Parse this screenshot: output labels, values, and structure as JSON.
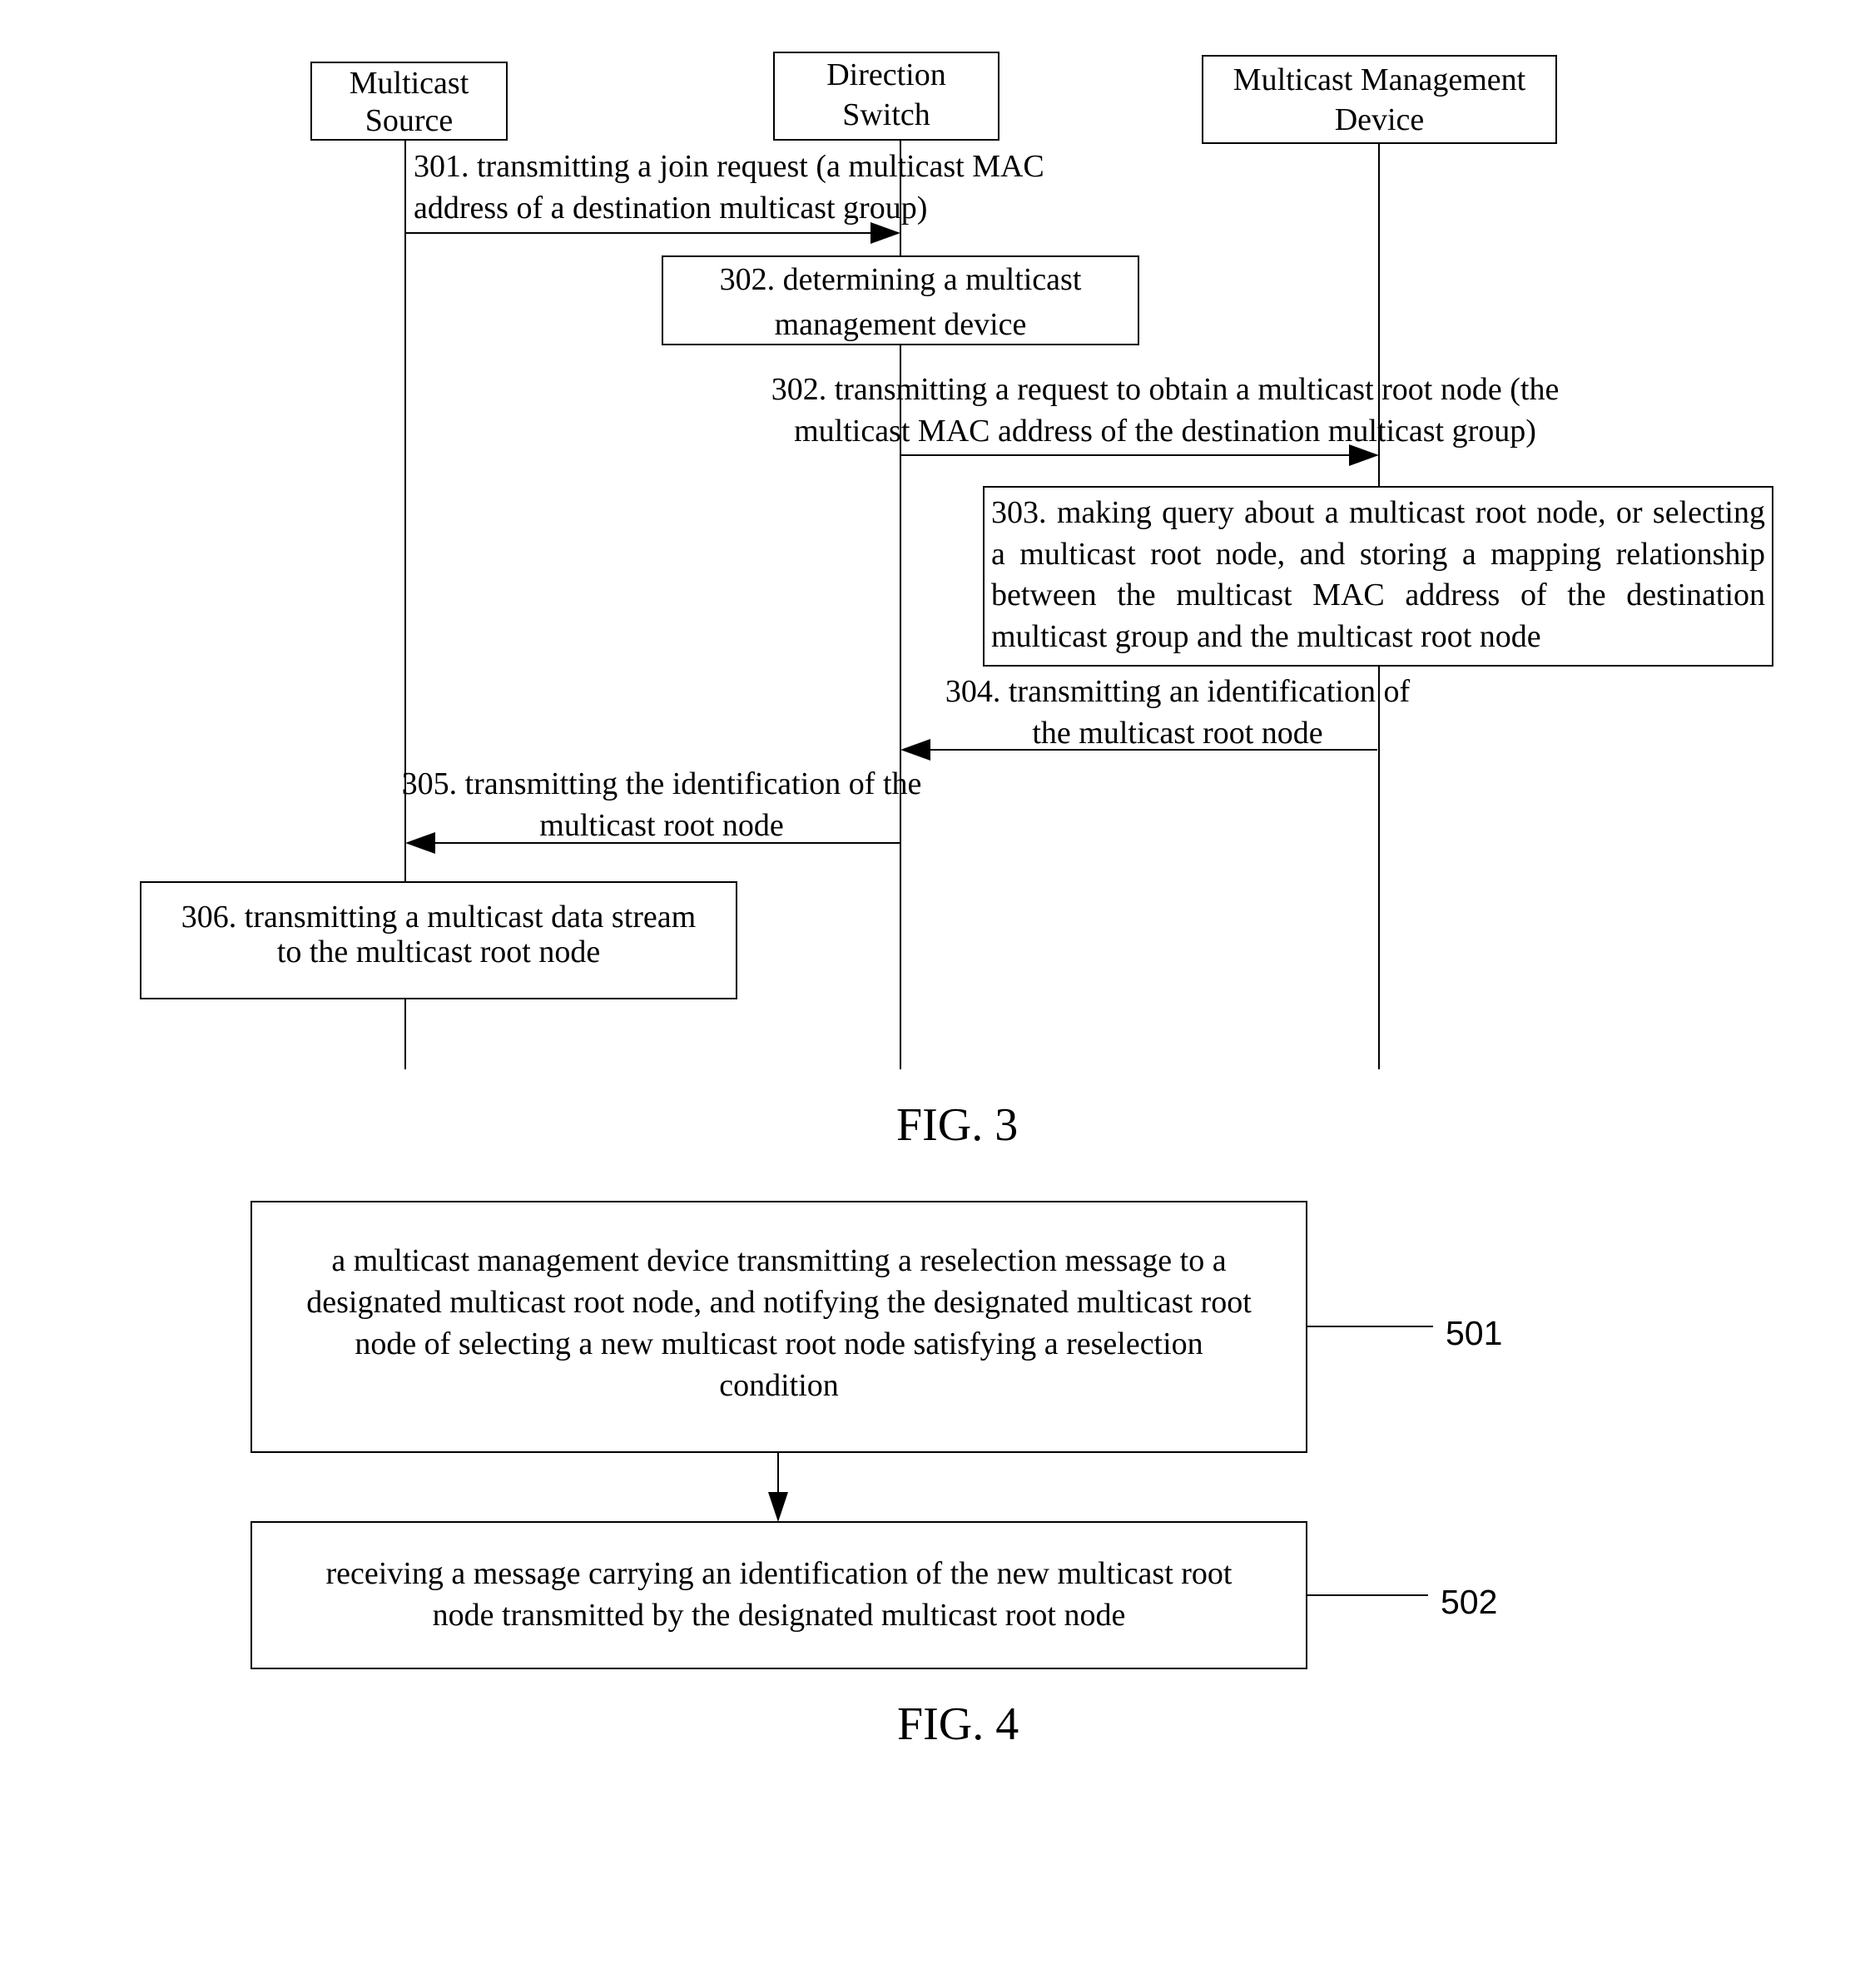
{
  "fig3": {
    "caption": "FIG. 3",
    "participants": [
      {
        "id": "multicast-source",
        "lines": [
          "Multicast",
          "Source"
        ]
      },
      {
        "id": "direction-switch",
        "lines": [
          "Direction",
          "Switch"
        ]
      },
      {
        "id": "multicast-management-device",
        "lines": [
          "Multicast Management",
          "Device"
        ]
      }
    ],
    "messages": {
      "m301": [
        "301. transmitting a join request (a multicast MAC",
        "address of a destination multicast group)"
      ],
      "m302": [
        "302. transmitting a request to obtain a multicast root node (the",
        "multicast MAC address of the destination multicast group)"
      ],
      "m304": [
        "304. transmitting an identification of",
        "the multicast root node"
      ],
      "m305": [
        "305. transmitting the identification of the",
        "multicast root node"
      ]
    },
    "steps": {
      "s302": [
        "302. determining a multicast",
        "management device"
      ],
      "s303": "303. making query about a multicast root node, or selecting a multicast root node, and storing a mapping relationship between the multicast MAC address of the destination multicast group and the multicast root node",
      "s306": [
        "306. transmitting a multicast data stream",
        "to the multicast root node"
      ]
    }
  },
  "fig4": {
    "caption": "FIG. 4",
    "steps": [
      {
        "ref": "501",
        "lines": [
          "a multicast management device transmitting a reselection message to a",
          "designated multicast root node, and notifying the designated multicast root",
          "node of selecting a new multicast root node satisfying a reselection",
          "condition"
        ]
      },
      {
        "ref": "502",
        "lines": [
          "receiving a message carrying an identification of the new multicast root",
          "node transmitted by the designated multicast root node"
        ]
      }
    ]
  }
}
